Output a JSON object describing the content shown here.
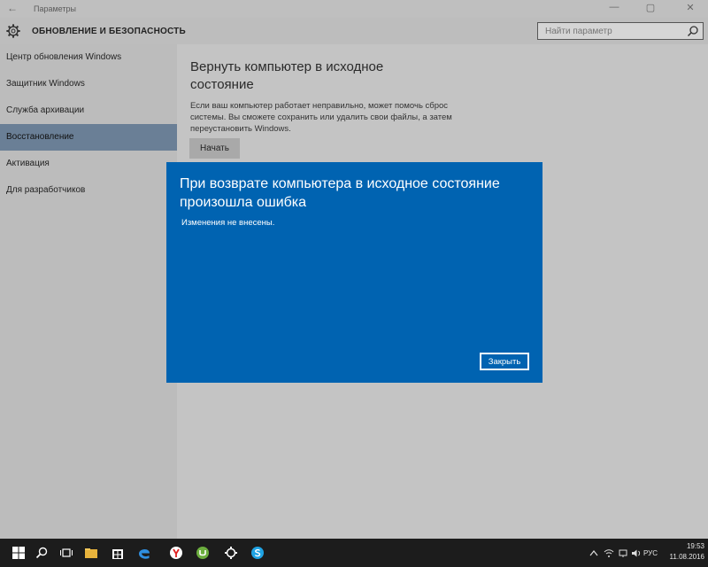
{
  "window": {
    "title": "Параметры",
    "back_glyph": "←",
    "minimize_glyph": "—",
    "maximize_glyph": "▢",
    "close_glyph": "✕"
  },
  "header": {
    "title": "ОБНОВЛЕНИЕ И БЕЗОПАСНОСТЬ",
    "icon": "gear-icon"
  },
  "search": {
    "placeholder": "Найти параметр",
    "icon": "search-icon"
  },
  "sidebar": {
    "items": [
      {
        "label": "Центр обновления Windows",
        "active": false
      },
      {
        "label": "Защитник Windows",
        "active": false
      },
      {
        "label": "Служба архивации",
        "active": false
      },
      {
        "label": "Восстановление",
        "active": true
      },
      {
        "label": "Активация",
        "active": false
      },
      {
        "label": "Для разработчиков",
        "active": false
      }
    ]
  },
  "content": {
    "heading": "Вернуть компьютер в исходное состояние",
    "description": "Если ваш компьютер работает неправильно, может помочь сброс системы. Вы сможете сохранить или удалить свои файлы, а затем переустановить Windows.",
    "start_label": "Начать"
  },
  "dialog": {
    "title": "При возврате компьютера в исходное состояние произошла ошибка",
    "message": "Изменения не внесены.",
    "close_label": "Закрыть",
    "background": "#0063b1"
  },
  "taskbar": {
    "apps": [
      "windows-start-icon",
      "search-icon",
      "task-view-icon",
      "file-explorer-icon",
      "store-icon",
      "edge-icon",
      "yandex-browser-icon",
      "utorrent-icon",
      "settings-icon",
      "skype-icon"
    ],
    "language": "РУС",
    "time": "19:53",
    "date": "11.08.2016"
  },
  "colors": {
    "accent": "#0063b1",
    "sidebar_active": "#6a7f96",
    "taskbar": "#1c1c1c"
  }
}
